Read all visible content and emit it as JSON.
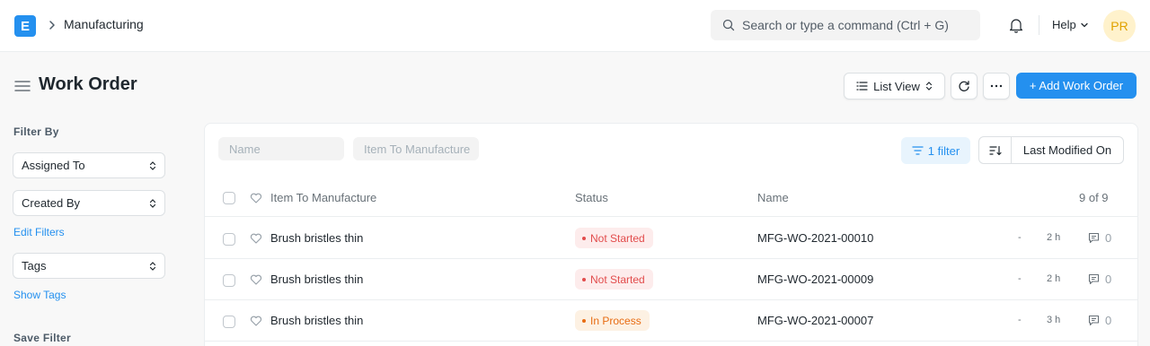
{
  "navbar": {
    "logo_letter": "E",
    "breadcrumb": "Manufacturing",
    "search_placeholder": "Search or type a command (Ctrl + G)",
    "help_label": "Help",
    "avatar_initials": "PR"
  },
  "page": {
    "title": "Work Order",
    "list_view_label": "List View",
    "add_button_label": "+ Add Work Order"
  },
  "sidebar": {
    "filter_heading": "Filter By",
    "assigned_to": "Assigned To",
    "created_by": "Created By",
    "edit_filters": "Edit Filters",
    "tags": "Tags",
    "show_tags": "Show Tags",
    "save_filter": "Save Filter"
  },
  "filters": {
    "name_placeholder": "Name",
    "item_placeholder": "Item To Manufacture",
    "filter_count": "1 filter",
    "sort_label": "Last Modified On"
  },
  "table": {
    "columns": {
      "item": "Item To Manufacture",
      "status": "Status",
      "name": "Name",
      "count": "9 of 9"
    },
    "rows": [
      {
        "item": "Brush bristles thin",
        "status": "Not Started",
        "name": "MFG-WO-2021-00010",
        "dash": "-",
        "time": "2 h",
        "comments": "0"
      },
      {
        "item": "Brush bristles thin",
        "status": "Not Started",
        "name": "MFG-WO-2021-00009",
        "dash": "-",
        "time": "2 h",
        "comments": "0"
      },
      {
        "item": "Brush bristles thin",
        "status": "In Process",
        "name": "MFG-WO-2021-00007",
        "dash": "-",
        "time": "3 h",
        "comments": "0"
      }
    ]
  },
  "colors": {
    "primary": "#2490ef",
    "status_not_started": "#e24c4c",
    "status_in_process": "#e86c13"
  },
  "icons": [
    "logo-icon",
    "chevron-right-icon",
    "search-icon",
    "bell-icon",
    "chevron-down-icon",
    "hamburger-icon",
    "list-icon",
    "refresh-icon",
    "ellipsis-icon",
    "filter-icon",
    "sort-icon",
    "heart-icon",
    "comment-icon"
  ]
}
